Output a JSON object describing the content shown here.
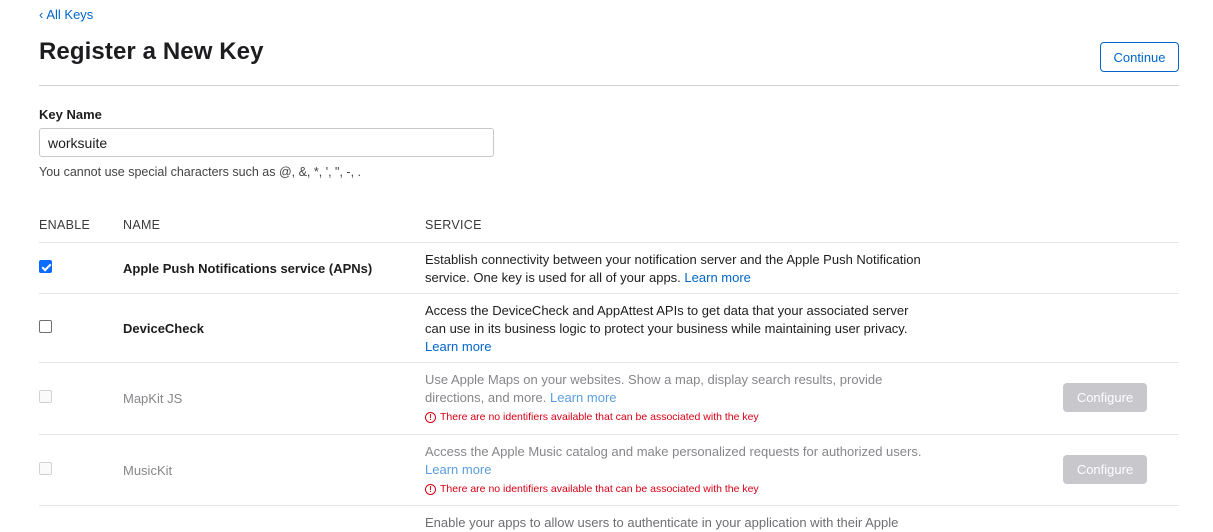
{
  "nav": {
    "back_label": "All Keys",
    "back_chevron": "‹"
  },
  "header": {
    "title": "Register a New Key",
    "continue_label": "Continue"
  },
  "key_name": {
    "label": "Key Name",
    "value": "worksuite",
    "hint": "You cannot use special characters such as @, &, *, ', \", -, ."
  },
  "table": {
    "columns": [
      "ENABLE",
      "NAME",
      "SERVICE"
    ],
    "rows": [
      {
        "name": "Apple Push Notifications service (APNs)",
        "checked": true,
        "enabled": true,
        "description": "Establish connectivity between your notification server and the Apple Push Notification service. One key is used for all of your apps.",
        "learn_more": "Learn more"
      },
      {
        "name": "DeviceCheck",
        "checked": false,
        "enabled": true,
        "description": "Access the DeviceCheck and AppAttest APIs to get data that your associated server can use in its business logic to protect your business while maintaining user privacy.",
        "learn_more": "Learn more"
      },
      {
        "name": "MapKit JS",
        "checked": false,
        "enabled": false,
        "description": "Use Apple Maps on your websites. Show a map, display search results, provide directions, and more.",
        "learn_more": "Learn more",
        "error": "There are no identifiers available that can be associated with the key",
        "configure_label": "Configure"
      },
      {
        "name": "MusicKit",
        "checked": false,
        "enabled": false,
        "description": "Access the Apple Music catalog and make personalized requests for authorized users.",
        "learn_more": "Learn more",
        "error": "There are no identifiers available that can be associated with the key",
        "configure_label": "Configure"
      },
      {
        "description": "Enable your apps to allow users to authenticate in your application with their Apple"
      }
    ]
  },
  "colors": {
    "accent": "#0066cc",
    "error": "#d70015",
    "checked": "#0a6cff",
    "disabled_button": "#c7c7cc"
  }
}
